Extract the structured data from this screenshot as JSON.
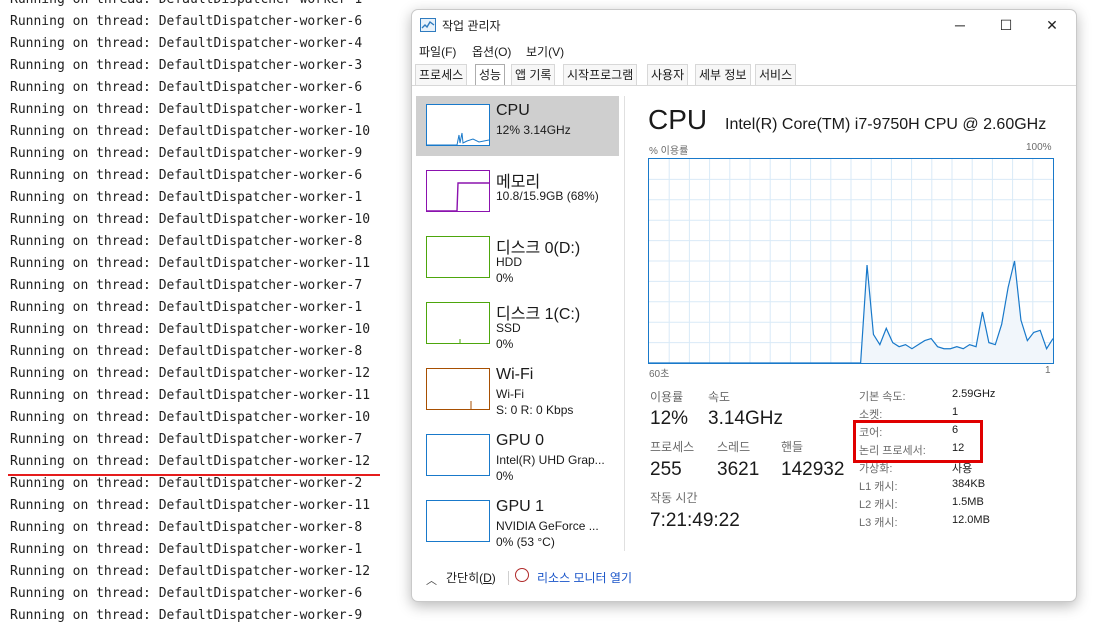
{
  "console": {
    "lines": [
      "Running on thread: DefaultDispatcher-worker-1",
      "Running on thread: DefaultDispatcher-worker-6",
      "Running on thread: DefaultDispatcher-worker-4",
      "Running on thread: DefaultDispatcher-worker-3",
      "Running on thread: DefaultDispatcher-worker-6",
      "Running on thread: DefaultDispatcher-worker-1",
      "Running on thread: DefaultDispatcher-worker-10",
      "Running on thread: DefaultDispatcher-worker-9",
      "Running on thread: DefaultDispatcher-worker-6",
      "Running on thread: DefaultDispatcher-worker-1",
      "Running on thread: DefaultDispatcher-worker-10",
      "Running on thread: DefaultDispatcher-worker-8",
      "Running on thread: DefaultDispatcher-worker-11",
      "Running on thread: DefaultDispatcher-worker-7",
      "Running on thread: DefaultDispatcher-worker-1",
      "Running on thread: DefaultDispatcher-worker-10",
      "Running on thread: DefaultDispatcher-worker-8",
      "Running on thread: DefaultDispatcher-worker-12",
      "Running on thread: DefaultDispatcher-worker-11",
      "Running on thread: DefaultDispatcher-worker-10",
      "Running on thread: DefaultDispatcher-worker-7",
      "Running on thread: DefaultDispatcher-worker-12",
      "Running on thread: DefaultDispatcher-worker-2",
      "Running on thread: DefaultDispatcher-worker-11",
      "Running on thread: DefaultDispatcher-worker-8",
      "Running on thread: DefaultDispatcher-worker-1",
      "Running on thread: DefaultDispatcher-worker-12",
      "Running on thread: DefaultDispatcher-worker-6",
      "Running on thread: DefaultDispatcher-worker-9"
    ]
  },
  "window": {
    "title": "작업 관리자",
    "icon": "task-manager-icon",
    "controls": {
      "minimize": "─",
      "maximize": "☐",
      "close": "✕"
    }
  },
  "menu": [
    "파일(F)",
    "옵션(O)",
    "보기(V)"
  ],
  "tabs": [
    {
      "label": "프로세스"
    },
    {
      "label": "성능",
      "active": true
    },
    {
      "label": "앱 기록"
    },
    {
      "label": "시작프로그램"
    },
    {
      "label": "사용자"
    },
    {
      "label": "세부 정보"
    },
    {
      "label": "서비스"
    }
  ],
  "sidebar": {
    "items": [
      {
        "name": "CPU",
        "line1": "12% 3.14GHz",
        "line2": "",
        "color": "#1979ca",
        "active": true
      },
      {
        "name": "메모리",
        "line1": "10.8/15.9GB (68%)",
        "line2": "",
        "color": "#8b12ae"
      },
      {
        "name": "디스크 0(D:)",
        "line1": "HDD",
        "line2": "0%",
        "color": "#4da60c"
      },
      {
        "name": "디스크 1(C:)",
        "line1": "SSD",
        "line2": "0%",
        "color": "#4da60c"
      },
      {
        "name": "Wi-Fi",
        "line1": "Wi-Fi",
        "line2": "S: 0 R: 0 Kbps",
        "color": "#a74f01"
      },
      {
        "name": "GPU 0",
        "line1": "Intel(R) UHD Grap...",
        "line2": "0%",
        "color": "#1979ca"
      },
      {
        "name": "GPU 1",
        "line1": "NVIDIA GeForce ...",
        "line2": "0% (53 °C)",
        "color": "#1979ca"
      }
    ]
  },
  "main": {
    "title": "CPU",
    "model": "Intel(R) Core(TM) i7-9750H CPU @ 2.60GHz",
    "graph_label_top_left": "% 이용률",
    "graph_label_top_right": "100%",
    "graph_label_bottom_left": "60초",
    "graph_label_bottom_right": "1",
    "stats": {
      "utilization_label": "이용률",
      "utilization": "12%",
      "speed_label": "속도",
      "speed": "3.14GHz",
      "processes_label": "프로세스",
      "processes": "255",
      "threads_label": "스레드",
      "threads": "3621",
      "handles_label": "핸들",
      "handles": "142932",
      "uptime_label": "작동 시간",
      "uptime": "7:21:49:22"
    },
    "details": [
      {
        "key": "기본 속도:",
        "value": "2.59GHz"
      },
      {
        "key": "소켓:",
        "value": "1"
      },
      {
        "key": "코어:",
        "value": "6"
      },
      {
        "key": "논리 프로세서:",
        "value": "12"
      },
      {
        "key": "가상화:",
        "value": "사용"
      },
      {
        "key": "L1 캐시:",
        "value": "384KB"
      },
      {
        "key": "L2 캐시:",
        "value": "1.5MB"
      },
      {
        "key": "L3 캐시:",
        "value": "12.0MB"
      }
    ]
  },
  "chart_data": {
    "type": "area",
    "x_range": [
      0,
      60
    ],
    "ylim": [
      0,
      100
    ],
    "grid": true,
    "series": [
      {
        "values": [
          0,
          0,
          0,
          0,
          0,
          0,
          0,
          0,
          0,
          0,
          0,
          0,
          0,
          0,
          0,
          0,
          0,
          0,
          0,
          0,
          0,
          0,
          0,
          0,
          0,
          0,
          0,
          0,
          0,
          0,
          0,
          0,
          0,
          0,
          48,
          14,
          9,
          17,
          10,
          8,
          9,
          7,
          9,
          11,
          12,
          8,
          7,
          7,
          8,
          7,
          9,
          8,
          25,
          10,
          9,
          19,
          37,
          50,
          21,
          11,
          15,
          16,
          7,
          12
        ]
      }
    ],
    "accent": "#1979ca"
  },
  "footer": {
    "fewer_prefix": "간단히(",
    "fewer_key": "D",
    "fewer_suffix": ")",
    "resource_monitor": "리소스 모니터 열기"
  },
  "annotations": {
    "highlight_color": "#e00000"
  }
}
